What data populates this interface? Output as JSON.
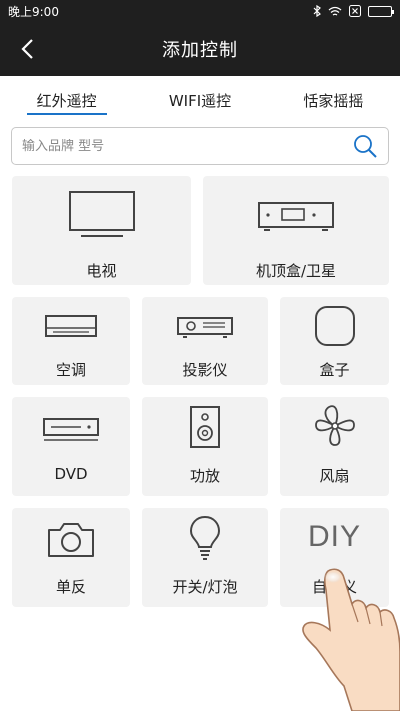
{
  "status": {
    "time": "晚上9:00"
  },
  "header": {
    "title": "添加控制"
  },
  "tabs": [
    {
      "label": "红外遥控",
      "active": true
    },
    {
      "label": "WIFI遥控",
      "active": false
    },
    {
      "label": "恬家摇摇",
      "active": false
    }
  ],
  "search": {
    "placeholder": "输入品牌 型号"
  },
  "devices": {
    "tv": "电视",
    "stb": "机顶盒/卫星",
    "ac": "空调",
    "projector": "投影仪",
    "box": "盒子",
    "dvd": "DVD",
    "amp": "功放",
    "fan": "风扇",
    "camera": "单反",
    "light": "开关/灯泡",
    "diy": "自定义",
    "diy_icon_text": "DIY"
  },
  "colors": {
    "accent": "#1a73c8",
    "header_bg": "#1f1f1f",
    "card_bg": "#f2f2f2"
  }
}
